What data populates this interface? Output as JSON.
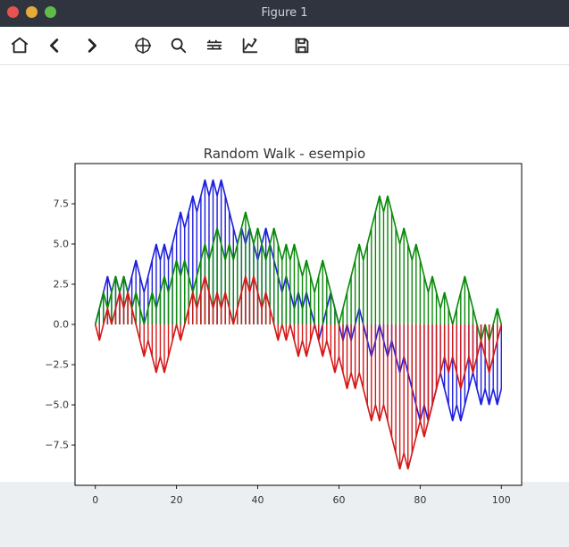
{
  "window": {
    "title": "Figure 1"
  },
  "toolbar": {
    "home": "Home",
    "back": "Back",
    "forward": "Forward",
    "pan": "Pan",
    "zoom": "Zoom",
    "subplots": "Configure subplots",
    "axes": "Edit axis",
    "save": "Save"
  },
  "chart_data": {
    "type": "line",
    "title": "Random Walk - esempio",
    "xlabel": "",
    "ylabel": "",
    "xlim": [
      -5,
      105
    ],
    "ylim": [
      -10,
      10
    ],
    "xticks": [
      0,
      20,
      40,
      60,
      80,
      100
    ],
    "yticks": [
      -7.5,
      -5.0,
      -2.5,
      0.0,
      2.5,
      5.0,
      7.5
    ],
    "xtick_labels": [
      "0",
      "20",
      "40",
      "60",
      "80",
      "100"
    ],
    "ytick_labels": [
      "−7.5",
      "−5.0",
      "−2.5",
      "0.0",
      "2.5",
      "5.0",
      "7.5"
    ],
    "x": [
      0,
      1,
      2,
      3,
      4,
      5,
      6,
      7,
      8,
      9,
      10,
      11,
      12,
      13,
      14,
      15,
      16,
      17,
      18,
      19,
      20,
      21,
      22,
      23,
      24,
      25,
      26,
      27,
      28,
      29,
      30,
      31,
      32,
      33,
      34,
      35,
      36,
      37,
      38,
      39,
      40,
      41,
      42,
      43,
      44,
      45,
      46,
      47,
      48,
      49,
      50,
      51,
      52,
      53,
      54,
      55,
      56,
      57,
      58,
      59,
      60,
      61,
      62,
      63,
      64,
      65,
      66,
      67,
      68,
      69,
      70,
      71,
      72,
      73,
      74,
      75,
      76,
      77,
      78,
      79,
      80,
      81,
      82,
      83,
      84,
      85,
      86,
      87,
      88,
      89,
      90,
      91,
      92,
      93,
      94,
      95,
      96,
      97,
      98,
      99,
      100
    ],
    "series": [
      {
        "name": "blue",
        "color": "#1f1fdd",
        "values": [
          0,
          1,
          2,
          3,
          2,
          3,
          2,
          3,
          2,
          3,
          4,
          3,
          2,
          3,
          4,
          5,
          4,
          5,
          4,
          5,
          6,
          7,
          6,
          7,
          8,
          7,
          8,
          9,
          8,
          9,
          8,
          9,
          8,
          7,
          6,
          5,
          6,
          5,
          6,
          5,
          4,
          5,
          6,
          5,
          4,
          3,
          2,
          3,
          2,
          1,
          2,
          1,
          2,
          1,
          0,
          -1,
          0,
          1,
          2,
          1,
          0,
          -1,
          0,
          -1,
          0,
          1,
          0,
          -1,
          -2,
          -1,
          0,
          -1,
          -2,
          -1,
          -2,
          -3,
          -2,
          -3,
          -4,
          -5,
          -6,
          -5,
          -6,
          -5,
          -4,
          -3,
          -4,
          -5,
          -6,
          -5,
          -6,
          -5,
          -4,
          -3,
          -4,
          -5,
          -4,
          -5,
          -4,
          -5,
          -4
        ]
      },
      {
        "name": "green",
        "color": "#0a8a0a",
        "values": [
          0,
          1,
          2,
          1,
          2,
          3,
          2,
          3,
          2,
          1,
          2,
          1,
          0,
          1,
          2,
          1,
          2,
          3,
          2,
          3,
          4,
          3,
          4,
          3,
          2,
          3,
          4,
          5,
          4,
          5,
          6,
          5,
          4,
          5,
          4,
          5,
          6,
          7,
          6,
          5,
          6,
          5,
          4,
          5,
          6,
          5,
          4,
          5,
          4,
          5,
          4,
          3,
          4,
          3,
          2,
          3,
          4,
          3,
          2,
          1,
          0,
          1,
          2,
          3,
          4,
          5,
          4,
          5,
          6,
          7,
          8,
          7,
          8,
          7,
          6,
          5,
          6,
          5,
          4,
          5,
          4,
          3,
          2,
          3,
          2,
          1,
          2,
          1,
          0,
          1,
          2,
          3,
          2,
          1,
          0,
          -1,
          0,
          -1,
          0,
          1,
          0
        ]
      },
      {
        "name": "red",
        "color": "#d31919",
        "values": [
          0,
          -1,
          0,
          1,
          0,
          1,
          2,
          1,
          2,
          1,
          0,
          -1,
          -2,
          -1,
          -2,
          -3,
          -2,
          -3,
          -2,
          -1,
          0,
          -1,
          0,
          1,
          2,
          1,
          2,
          3,
          2,
          1,
          2,
          1,
          2,
          1,
          0,
          1,
          2,
          3,
          2,
          3,
          2,
          1,
          2,
          1,
          0,
          -1,
          0,
          -1,
          0,
          -1,
          -2,
          -1,
          -2,
          -1,
          0,
          -1,
          -2,
          -1,
          -2,
          -3,
          -2,
          -3,
          -4,
          -3,
          -4,
          -3,
          -4,
          -5,
          -6,
          -5,
          -6,
          -5,
          -6,
          -7,
          -8,
          -9,
          -8,
          -9,
          -8,
          -7,
          -6,
          -7,
          -6,
          -5,
          -4,
          -3,
          -2,
          -3,
          -2,
          -3,
          -4,
          -3,
          -2,
          -3,
          -2,
          -1,
          -2,
          -3,
          -2,
          -1,
          0
        ]
      }
    ],
    "style": "stem_fill_to_zero"
  }
}
